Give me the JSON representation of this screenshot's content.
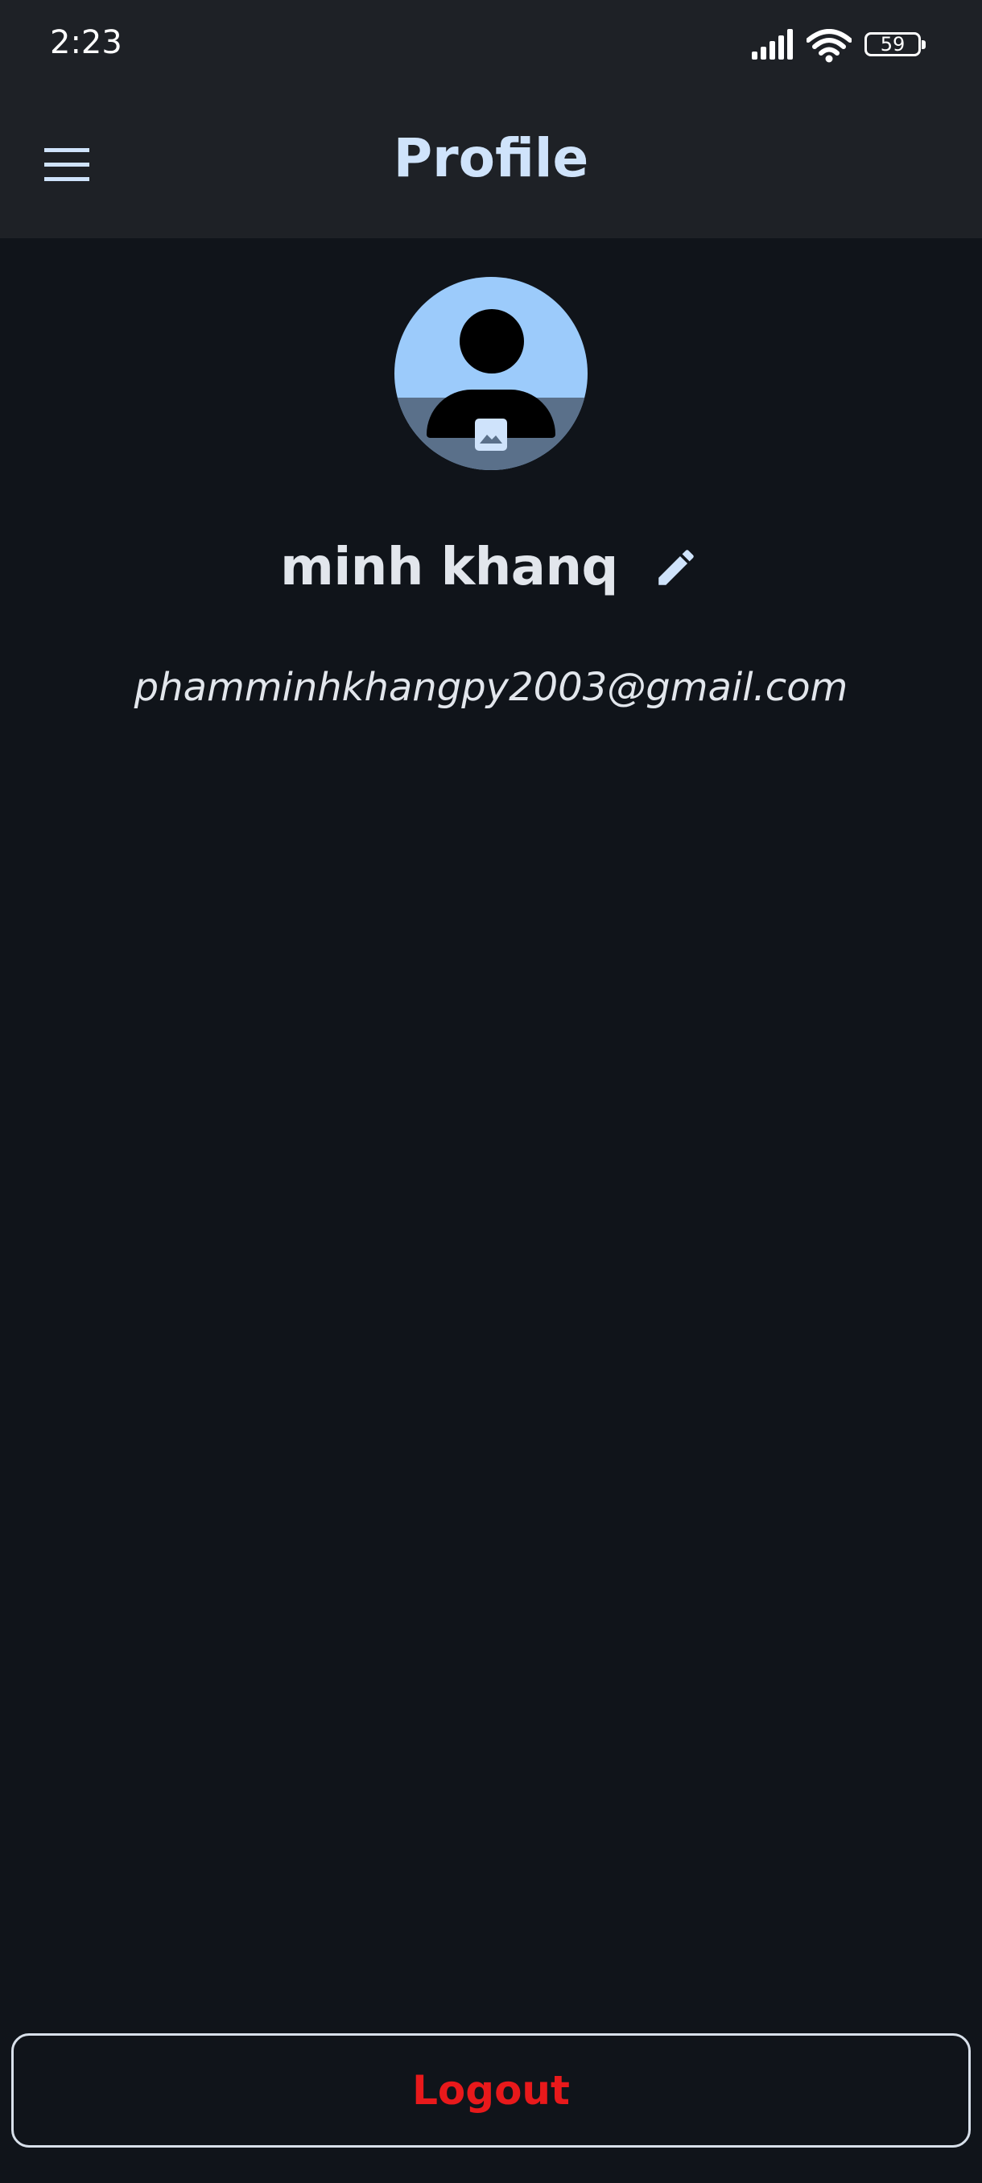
{
  "status_bar": {
    "time": "2:23",
    "battery_level": "59",
    "icons": [
      "signal-icon",
      "wifi-icon",
      "battery-icon"
    ]
  },
  "app_bar": {
    "title": "Profile",
    "menu_icon": "menu-icon"
  },
  "profile": {
    "avatar_icon": "person-icon",
    "photo_icon": "image-icon",
    "name": "minh khanq",
    "edit_icon": "pencil-icon",
    "email": "phamminhkhangpy2003@gmail.com"
  },
  "actions": {
    "logout_label": "Logout"
  },
  "colors": {
    "background": "#10141a",
    "bar": "#1e2126",
    "title": "#cfe3fb",
    "logout_text": "#e8191b",
    "avatar_light": "#9ccbfb",
    "avatar_dark": "#5a708a"
  }
}
